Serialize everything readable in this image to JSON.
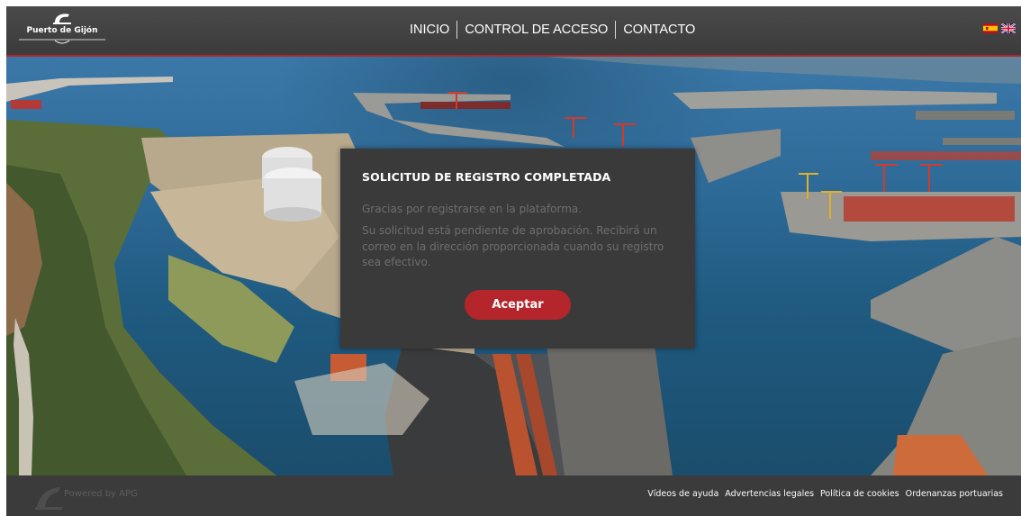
{
  "header": {
    "logo_text": "Puerto de Gijón",
    "nav": [
      {
        "label": "INICIO"
      },
      {
        "label": "CONTROL DE ACCESO"
      },
      {
        "label": "CONTACTO"
      }
    ],
    "languages": [
      "es",
      "en"
    ]
  },
  "modal": {
    "title": "SOLICITUD DE REGISTRO COMPLETADA",
    "line1": "Gracias por registrarse en la plataforma.",
    "line2": "Su solicitud está pendiente de aprobación. Recibirá un correo en la dirección proporcionada cuando su registro sea efectivo.",
    "accept_label": "Aceptar"
  },
  "footer": {
    "powered": "Powered by APG",
    "links": [
      "Vídeos de ayuda",
      "Advertencias legales",
      "Política de cookies",
      "Ordenanzas portuarias"
    ]
  },
  "colors": {
    "accent": "#b4262b",
    "header_bg": "#3b3b3b",
    "modal_bg": "#3a3a3a"
  },
  "icons": [
    "puerto-gijon-logo",
    "spain-flag-icon",
    "uk-flag-icon",
    "apg-logo-icon"
  ]
}
